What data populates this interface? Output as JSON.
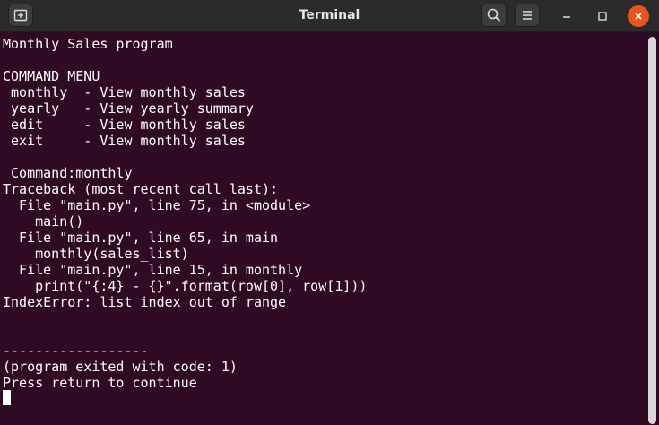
{
  "window": {
    "title": "Terminal"
  },
  "icons": {
    "new_tab": "new-tab-icon",
    "search": "search-icon",
    "menu": "hamburger-menu-icon",
    "minimize": "minimize-icon",
    "maximize": "maximize-icon",
    "close": "close-icon"
  },
  "colors": {
    "terminal_bg": "#300a24",
    "titlebar_bg": "#2b2b2b",
    "close_accent": "#e95420",
    "text": "#ffffff"
  },
  "terminal": {
    "lines": [
      "Monthly Sales program",
      "",
      "COMMAND MENU",
      " monthly  - View monthly sales",
      " yearly   - View yearly summary",
      " edit     - View monthly sales",
      " exit     - View monthly sales",
      "",
      " Command:monthly",
      "Traceback (most recent call last):",
      "  File \"main.py\", line 75, in <module>",
      "    main()",
      "  File \"main.py\", line 65, in main",
      "    monthly(sales_list)",
      "  File \"main.py\", line 15, in monthly",
      "    print(\"{:4} - {}\".format(row[0], row[1]))",
      "IndexError: list index out of range",
      "",
      "",
      "------------------",
      "(program exited with code: 1)",
      "Press return to continue"
    ]
  }
}
